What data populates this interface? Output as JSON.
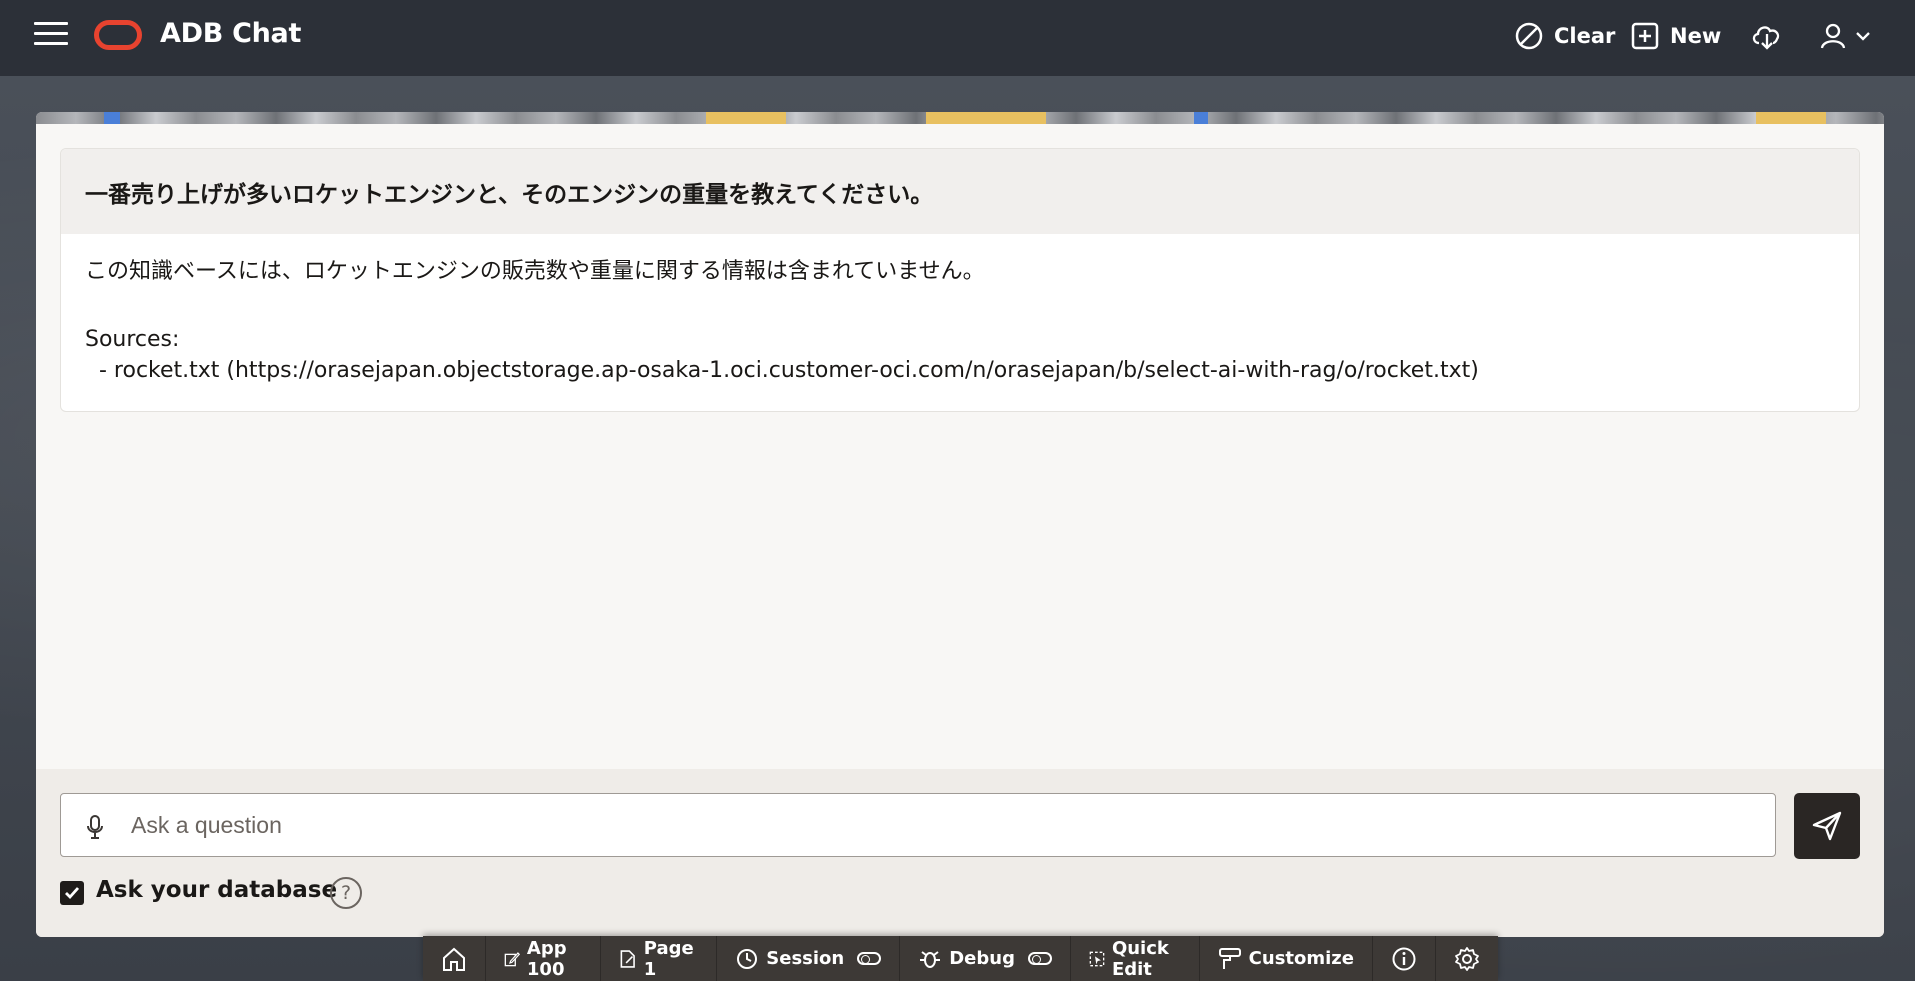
{
  "header": {
    "title": "ADB Chat",
    "clear_label": "Clear",
    "new_label": "New"
  },
  "conversation": {
    "question": "一番売り上げが多いロケットエンジンと、そのエンジンの重量を教えてください。",
    "answer": "この知識ベースには、ロケットエンジンの販売数や重量に関する情報は含まれていません。",
    "sources_label": "Sources:",
    "source_item": "  - rocket.txt (https://orasejapan.objectstorage.ap-osaka-1.oci.customer-oci.com/n/orasejapan/b/select-ai-with-rag/o/rocket.txt)"
  },
  "input": {
    "placeholder": "Ask a question",
    "value": ""
  },
  "options": {
    "ask_db_label": "Ask your database",
    "ask_db_checked": true,
    "help_glyph": "?"
  },
  "devbar": {
    "app": "App 100",
    "page": "Page 1",
    "session": "Session",
    "debug": "Debug",
    "quick_edit": "Quick Edit",
    "customize": "Customize"
  },
  "colors": {
    "header_bg": "#2c3038",
    "brand": "#e8432f",
    "send_bg": "#2a2624",
    "devbar_bg": "#3d3936"
  },
  "icons": [
    "menu-icon",
    "oracle-logo",
    "clear-icon",
    "new-icon",
    "cloud-download-icon",
    "user-icon",
    "chevron-down-icon",
    "microphone-icon",
    "send-icon",
    "check-icon",
    "help-icon",
    "home-icon",
    "edit-icon",
    "page-icon",
    "session-icon",
    "debug-icon",
    "quick-edit-icon",
    "customize-icon",
    "info-icon",
    "gear-icon"
  ]
}
